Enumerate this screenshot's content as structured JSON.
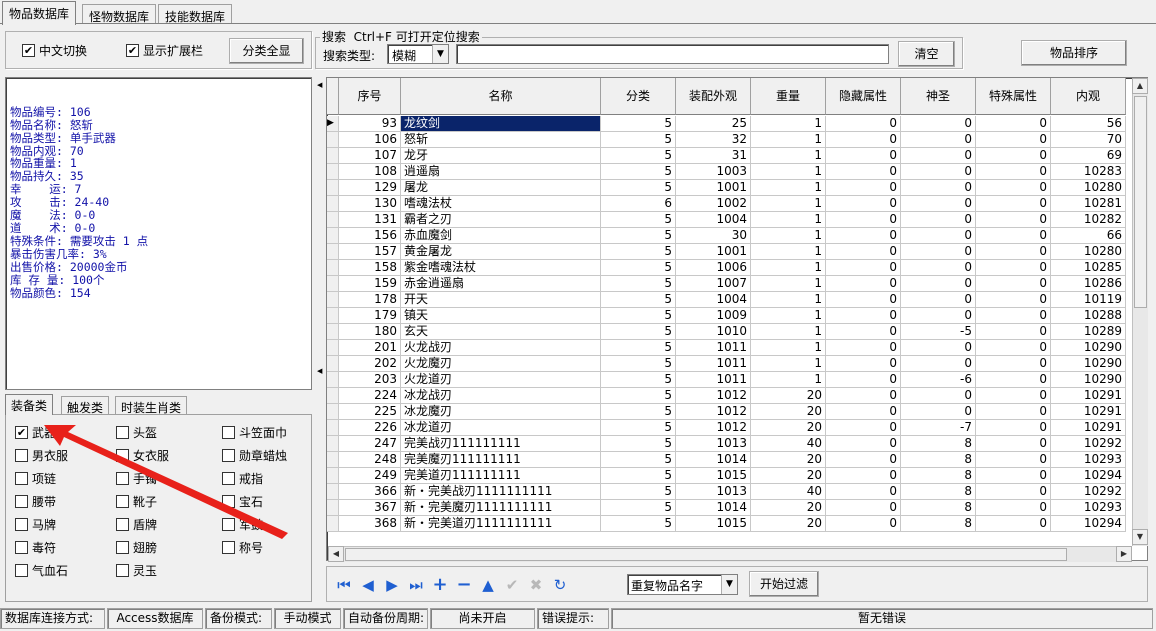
{
  "tabs": [
    "物品数据库",
    "怪物数据库",
    "技能数据库"
  ],
  "toolbar": {
    "chinese_switch": "中文切换",
    "show_extended": "显示扩展栏",
    "show_all_categories": "分类全显",
    "search_title": "搜索  Ctrl+F 可打开定位搜索",
    "search_type_label": "搜索类型:",
    "search_type_value": "模糊",
    "search_value": "",
    "clear_button": "清空",
    "sort_button": "物品排序"
  },
  "info_lines": [
    "物品编号: 106",
    "物品名称: 怒斩",
    "物品类型: 单手武器",
    "物品内观: 70",
    "物品重量: 1",
    "物品持久: 35",
    "幸    运: 7",
    "攻    击: 24-40",
    "魔    法: 0-0",
    "道    术: 0-0",
    "特殊条件: 需要攻击 1 点",
    "暴击伤害几率: 3%",
    "出售价格: 20000金币",
    "库 存 量: 100个",
    "物品颜色: 154"
  ],
  "sub_tabs": [
    "装备类",
    "触发类",
    "时装生肖类"
  ],
  "categories": [
    {
      "label": "武器",
      "checked": true
    },
    {
      "label": "头盔",
      "checked": false
    },
    {
      "label": "斗笠面巾",
      "checked": false
    },
    {
      "label": "男衣服",
      "checked": false
    },
    {
      "label": "女衣服",
      "checked": false
    },
    {
      "label": "勋章蜡烛",
      "checked": false
    },
    {
      "label": "项链",
      "checked": false
    },
    {
      "label": "手镯",
      "checked": false
    },
    {
      "label": "戒指",
      "checked": false
    },
    {
      "label": "腰带",
      "checked": false
    },
    {
      "label": "靴子",
      "checked": false
    },
    {
      "label": "宝石",
      "checked": false
    },
    {
      "label": "马牌",
      "checked": false
    },
    {
      "label": "盾牌",
      "checked": false
    },
    {
      "label": "军鼓",
      "checked": false
    },
    {
      "label": "毒符",
      "checked": false
    },
    {
      "label": "翅膀",
      "checked": false
    },
    {
      "label": "称号",
      "checked": false
    },
    {
      "label": "气血石",
      "checked": false
    },
    {
      "label": "灵玉",
      "checked": false
    }
  ],
  "grid": {
    "columns": [
      "序号",
      "名称",
      "分类",
      "装配外观",
      "重量",
      "隐藏属性",
      "神圣",
      "特殊属性",
      "内观"
    ],
    "rows": [
      [
        "93",
        "龙纹剑",
        "5",
        "25",
        "1",
        "0",
        "0",
        "0",
        "56"
      ],
      [
        "106",
        "怒斩",
        "5",
        "32",
        "1",
        "0",
        "0",
        "0",
        "70"
      ],
      [
        "107",
        "龙牙",
        "5",
        "31",
        "1",
        "0",
        "0",
        "0",
        "69"
      ],
      [
        "108",
        "逍遥扇",
        "5",
        "1003",
        "1",
        "0",
        "0",
        "0",
        "10283"
      ],
      [
        "129",
        "屠龙",
        "5",
        "1001",
        "1",
        "0",
        "0",
        "0",
        "10280"
      ],
      [
        "130",
        "嗜魂法杖",
        "6",
        "1002",
        "1",
        "0",
        "0",
        "0",
        "10281"
      ],
      [
        "131",
        "霸者之刃",
        "5",
        "1004",
        "1",
        "0",
        "0",
        "0",
        "10282"
      ],
      [
        "156",
        "赤血魔剑",
        "5",
        "30",
        "1",
        "0",
        "0",
        "0",
        "66"
      ],
      [
        "157",
        "黄金屠龙",
        "5",
        "1001",
        "1",
        "0",
        "0",
        "0",
        "10280"
      ],
      [
        "158",
        "紫金嗜魂法杖",
        "5",
        "1006",
        "1",
        "0",
        "0",
        "0",
        "10285"
      ],
      [
        "159",
        "赤金逍遥扇",
        "5",
        "1007",
        "1",
        "0",
        "0",
        "0",
        "10286"
      ],
      [
        "178",
        "开天",
        "5",
        "1004",
        "1",
        "0",
        "0",
        "0",
        "10119"
      ],
      [
        "179",
        "镇天",
        "5",
        "1009",
        "1",
        "0",
        "0",
        "0",
        "10288"
      ],
      [
        "180",
        "玄天",
        "5",
        "1010",
        "1",
        "0",
        "-5",
        "0",
        "10289"
      ],
      [
        "201",
        "火龙战刃",
        "5",
        "1011",
        "1",
        "0",
        "0",
        "0",
        "10290"
      ],
      [
        "202",
        "火龙魔刃",
        "5",
        "1011",
        "1",
        "0",
        "0",
        "0",
        "10290"
      ],
      [
        "203",
        "火龙道刃",
        "5",
        "1011",
        "1",
        "0",
        "-6",
        "0",
        "10290"
      ],
      [
        "224",
        "冰龙战刃",
        "5",
        "1012",
        "20",
        "0",
        "0",
        "0",
        "10291"
      ],
      [
        "225",
        "冰龙魔刃",
        "5",
        "1012",
        "20",
        "0",
        "0",
        "0",
        "10291"
      ],
      [
        "226",
        "冰龙道刃",
        "5",
        "1012",
        "20",
        "0",
        "-7",
        "0",
        "10291"
      ],
      [
        "247",
        "完美战刃111111111",
        "5",
        "1013",
        "40",
        "0",
        "8",
        "0",
        "10292"
      ],
      [
        "248",
        "完美魔刃111111111",
        "5",
        "1014",
        "20",
        "0",
        "8",
        "0",
        "10293"
      ],
      [
        "249",
        "完美道刃111111111",
        "5",
        "1015",
        "20",
        "0",
        "8",
        "0",
        "10294"
      ],
      [
        "366",
        "新・完美战刃1111111111",
        "5",
        "1013",
        "40",
        "0",
        "8",
        "0",
        "10292"
      ],
      [
        "367",
        "新・完美魔刃1111111111",
        "5",
        "1014",
        "20",
        "0",
        "8",
        "0",
        "10293"
      ],
      [
        "368",
        "新・完美道刃1111111111",
        "5",
        "1015",
        "20",
        "0",
        "8",
        "0",
        "10294"
      ]
    ],
    "selected_row": 0
  },
  "filter": {
    "dropdown_value": "重复物品名字",
    "start_filter_button": "开始过滤"
  },
  "status": {
    "db_conn_label": "数据库连接方式:",
    "db_conn_value": "Access数据库",
    "backup_mode_label": "备份模式:",
    "backup_mode_value": "手动模式",
    "auto_backup_label": "自动备份周期:",
    "auto_backup_value": "尚未开启",
    "error_label": "错误提示:",
    "error_value": "暂无错误"
  },
  "colors": {
    "selection": "#0a246a",
    "info_text": "#1212a8",
    "annotation_arrow": "#e8211a",
    "nav_icon": "#1f5fd1"
  }
}
